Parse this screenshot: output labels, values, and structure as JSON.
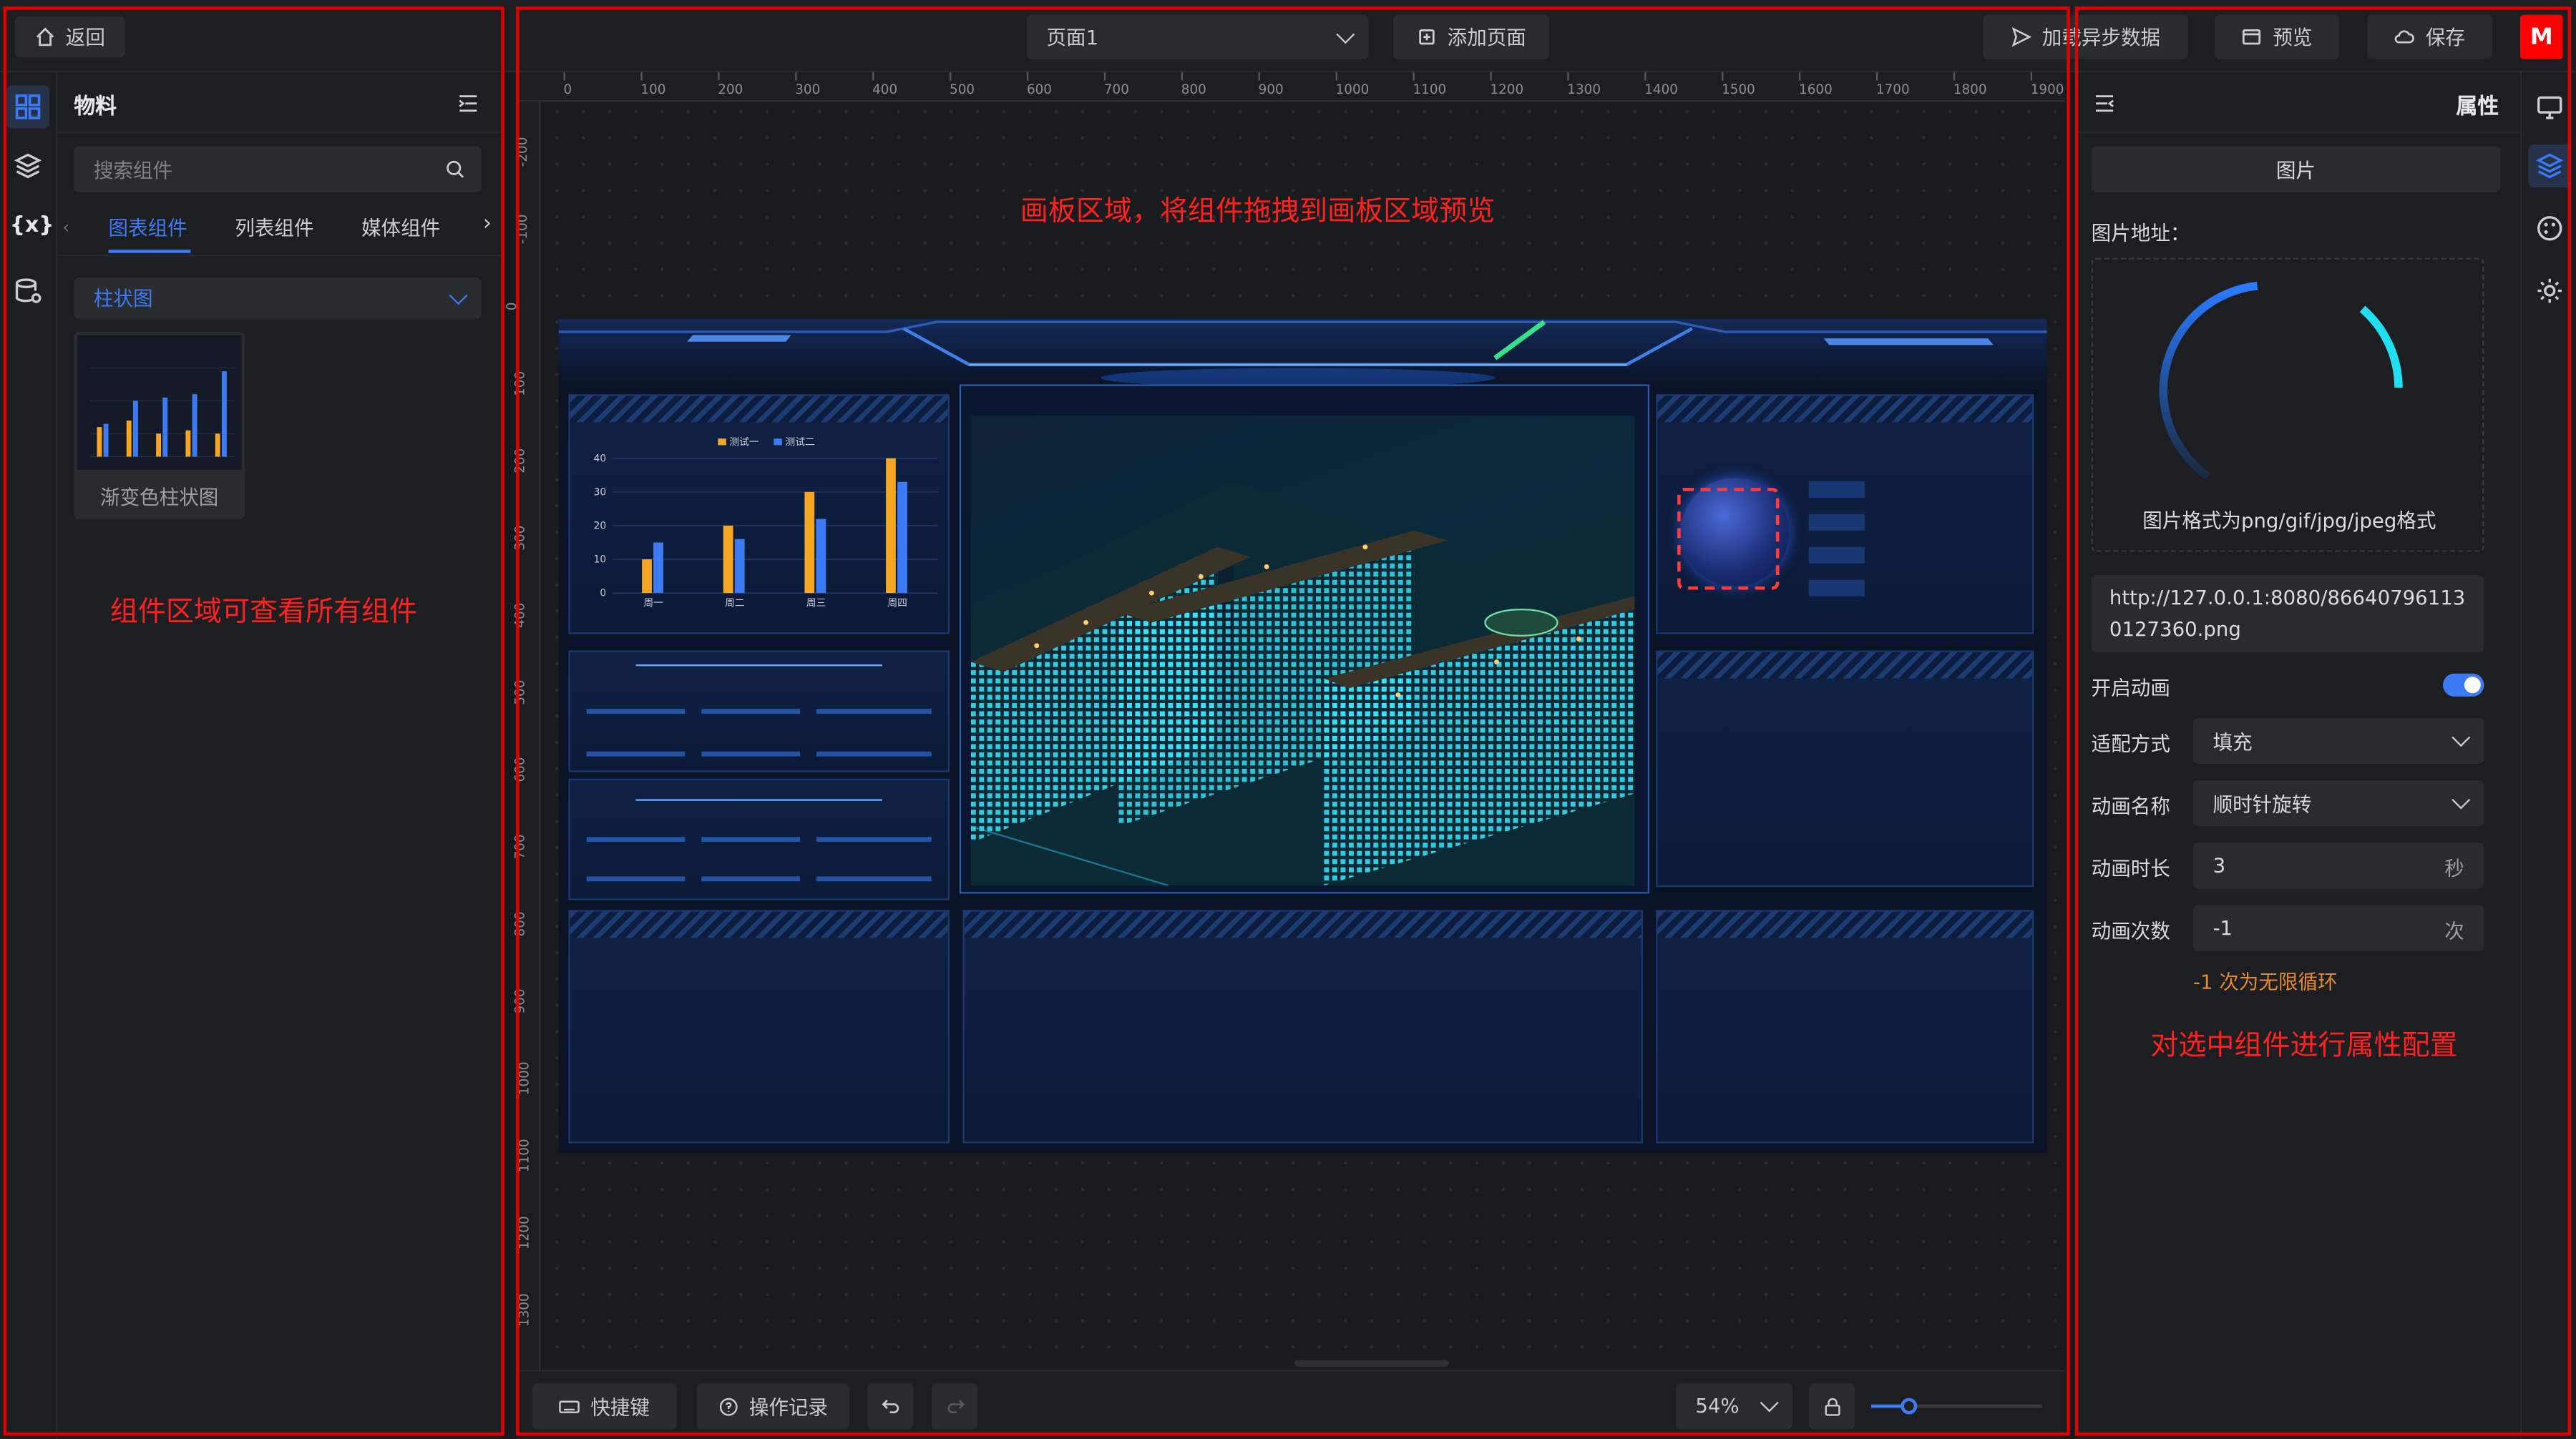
{
  "topbar": {
    "back_label": "返回",
    "page_select": "页面1",
    "add_page_label": "添加页面",
    "load_async_label": "加载异步数据",
    "preview_label": "预览",
    "save_label": "保存",
    "avatar_letter": "M"
  },
  "left_panel": {
    "title": "物料",
    "search_placeholder": "搜索组件",
    "tabs": [
      "图表组件",
      "列表组件",
      "媒体组件"
    ],
    "active_tab": "图表组件",
    "category": "柱状图",
    "components": [
      {
        "label": "渐变色柱状图"
      }
    ]
  },
  "canvas": {
    "ruler_x": [
      "0",
      "100",
      "200",
      "300",
      "400",
      "500",
      "600",
      "700",
      "800",
      "900",
      "1000",
      "1100",
      "1200",
      "1300",
      "1400",
      "1500",
      "1600",
      "1700",
      "1800",
      "1900"
    ],
    "ruler_y": [
      "-200",
      "-100",
      "0",
      "100",
      "200",
      "300",
      "400",
      "500",
      "600",
      "700",
      "800",
      "900",
      "1000",
      "1100",
      "1200",
      "1300"
    ]
  },
  "annotations": {
    "canvas_note": "画板区域，将组件拖拽到画板区域预览",
    "components_note": "组件区域可查看所有组件",
    "properties_note": "对选中组件进行属性配置"
  },
  "bottom_bar": {
    "shortcuts_label": "快捷键",
    "history_label": "操作记录",
    "zoom_value": "54%"
  },
  "right_panel": {
    "title": "属性",
    "component_name": "图片",
    "image_url_label": "图片地址：",
    "image_format_hint": "图片格式为png/gif/jpg/jpeg格式",
    "image_url_value": "http://127.0.0.1:8080/866407961130127360.png",
    "animation_enabled_label": "开启动画",
    "animation_enabled": true,
    "fit_label": "适配方式",
    "fit_value": "填充",
    "anim_name_label": "动画名称",
    "anim_name_value": "顺时针旋转",
    "anim_duration_label": "动画时长",
    "anim_duration_value": "3",
    "anim_duration_unit": "秒",
    "anim_count_label": "动画次数",
    "anim_count_value": "-1",
    "anim_count_unit": "次",
    "anim_count_hint": "-1 次为无限循环"
  },
  "chart_data": {
    "type": "bar",
    "categories": [
      "周一",
      "周二",
      "周三",
      "周四"
    ],
    "series": [
      {
        "name": "测试一",
        "values": [
          10,
          20,
          30,
          40
        ]
      },
      {
        "name": "测试二",
        "values": [
          15,
          16,
          22,
          33
        ]
      }
    ],
    "ylim": [
      0,
      40
    ],
    "yticks": [
      "0",
      "10",
      "20",
      "30",
      "40"
    ],
    "colors": [
      "#f5a623",
      "#3d7bf5"
    ],
    "legend": "top"
  },
  "colors": {
    "accent": "#3d7bf5",
    "annotation": "#ff2020",
    "hint": "#e88a2c"
  }
}
